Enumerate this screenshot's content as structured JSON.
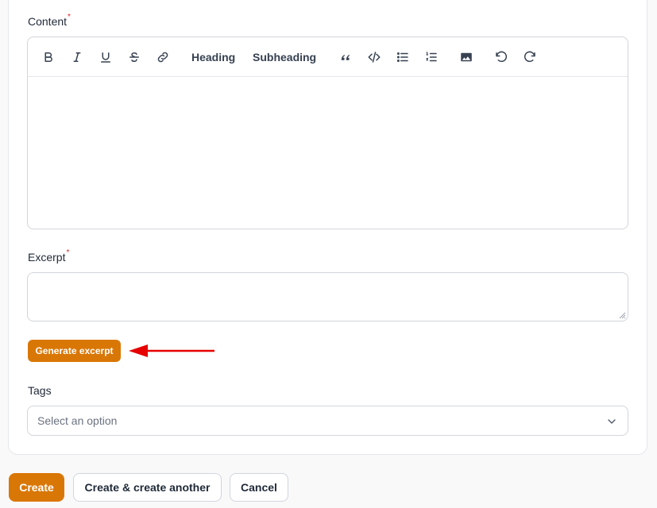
{
  "content": {
    "label": "Content",
    "required_mark": "*",
    "toolbar": {
      "heading": "Heading",
      "subheading": "Subheading"
    }
  },
  "excerpt": {
    "label": "Excerpt",
    "required_mark": "*",
    "value": "",
    "generate_label": "Generate excerpt"
  },
  "tags": {
    "label": "Tags",
    "placeholder": "Select an option"
  },
  "actions": {
    "create": "Create",
    "create_another": "Create & create another",
    "cancel": "Cancel"
  },
  "colors": {
    "accent": "#d97706",
    "annotation_arrow": "#e60000",
    "required": "#dc2626"
  }
}
